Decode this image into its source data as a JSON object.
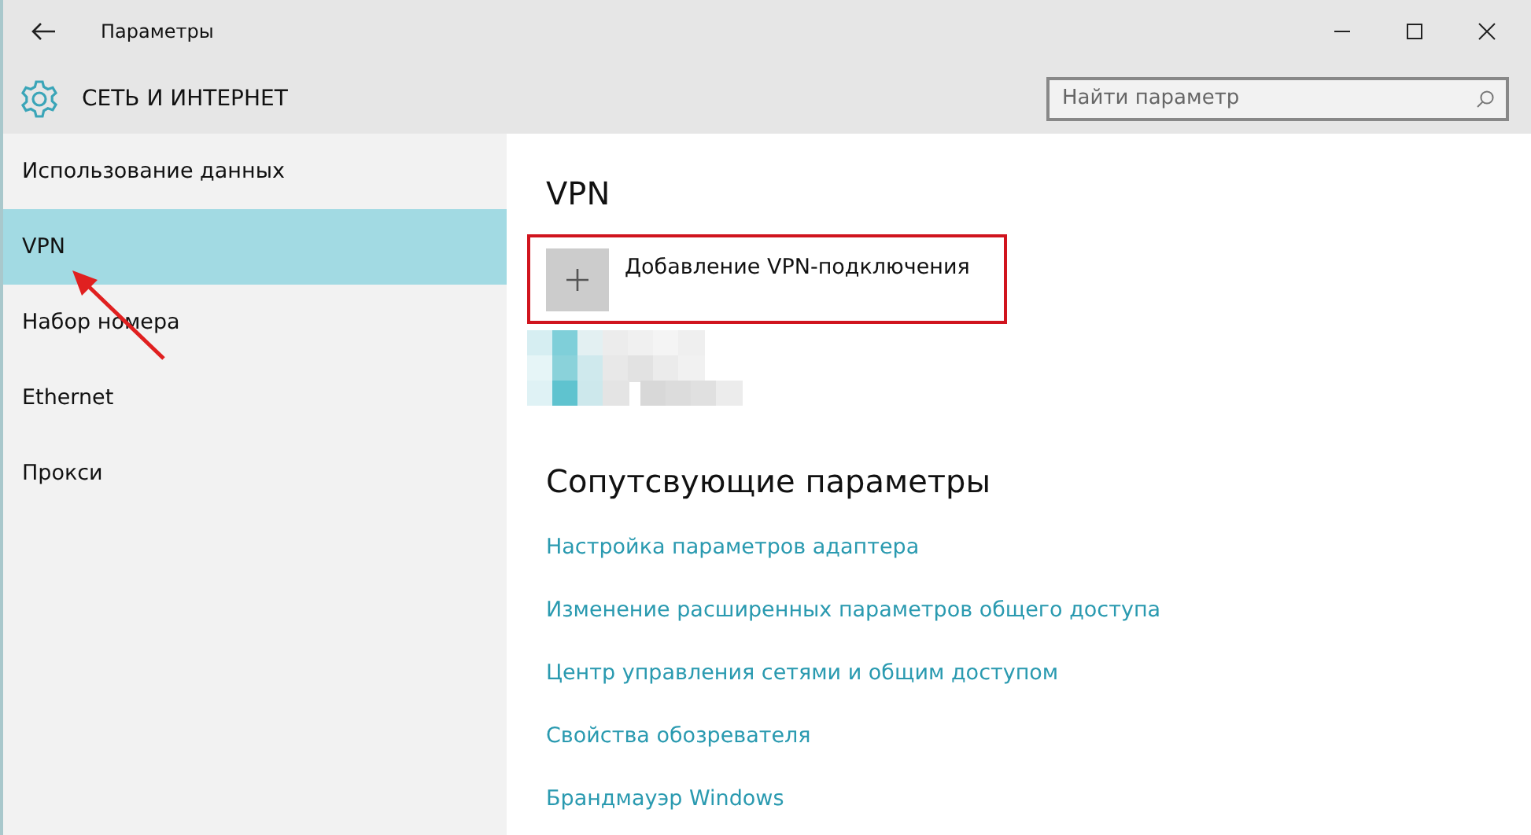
{
  "window": {
    "title": "Параметры"
  },
  "header": {
    "title": "СЕТЬ И ИНТЕРНЕТ",
    "search": {
      "placeholder": "Найти параметр"
    }
  },
  "sidebar": {
    "items": [
      {
        "label": "Использование данных",
        "selected": false
      },
      {
        "label": "VPN",
        "selected": true
      },
      {
        "label": "Набор номера",
        "selected": false
      },
      {
        "label": "Ethernet",
        "selected": false
      },
      {
        "label": "Прокси",
        "selected": false
      }
    ]
  },
  "content": {
    "title": "VPN",
    "add_button": {
      "label": "Добавление VPN-подключения",
      "highlighted": true
    },
    "related": {
      "title": "Сопутсвующие параметры",
      "links": [
        "Настройка параметров адаптера",
        "Изменение расширенных параметров общего доступа",
        "Центр управления сетями и общим доступом",
        "Свойства обозревателя",
        "Брандмауэр Windows"
      ]
    }
  },
  "annotation": {
    "arrow": true
  }
}
